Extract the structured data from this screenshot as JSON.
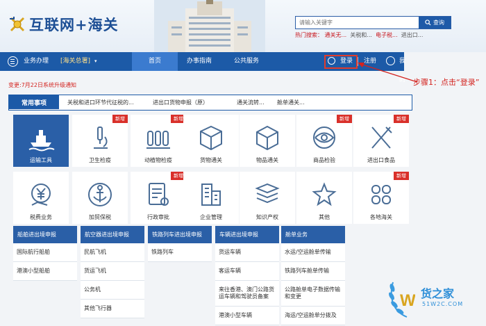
{
  "header": {
    "logo_text": "互联网+海关",
    "search": {
      "placeholder": "请输入关键字",
      "button": "查询"
    },
    "hot": {
      "label": "热门搜索：",
      "items": [
        "通关无...",
        "关税和...",
        "电子税...",
        "进出口..."
      ]
    }
  },
  "nav": {
    "business": "业务办理",
    "office": "[海关总署]",
    "home": "首页",
    "guide": "办事指南",
    "public": "公共服务",
    "login": "登录",
    "register": "注册",
    "mine": "我的"
  },
  "annotation": "步骤1：点击“登录”",
  "notice": "变更:7月22日系统升级通知",
  "quick": {
    "tab": "常用事项",
    "links": [
      "关税和进口环节代征税的...",
      "进出口货物申报（原）",
      "通关流转...",
      "舱单通关..."
    ]
  },
  "tiles": [
    {
      "label": "运输工具",
      "icon": "ship-icon",
      "new": false,
      "active": true
    },
    {
      "label": "卫生检疫",
      "icon": "microscope-icon",
      "new": true,
      "active": false
    },
    {
      "label": "动植物检疫",
      "icon": "plant-icon",
      "new": true,
      "active": false
    },
    {
      "label": "货物通关",
      "icon": "box-icon",
      "new": false,
      "active": false
    },
    {
      "label": "物品通关",
      "icon": "cube-icon",
      "new": false,
      "active": false
    },
    {
      "label": "商品检验",
      "icon": "eye-icon",
      "new": true,
      "active": false
    },
    {
      "label": "进出口食品",
      "icon": "utensils-icon",
      "new": true,
      "active": false
    },
    {
      "label": "税费业务",
      "icon": "yen-icon",
      "new": false,
      "active": false
    },
    {
      "label": "加贸保税",
      "icon": "anchor-icon",
      "new": false,
      "active": false
    },
    {
      "label": "行政审批",
      "icon": "document-icon",
      "new": true,
      "active": false
    },
    {
      "label": "企业管理",
      "icon": "building-icon",
      "new": false,
      "active": false
    },
    {
      "label": "知识产权",
      "icon": "layers-icon",
      "new": false,
      "active": false
    },
    {
      "label": "其他",
      "icon": "pin-icon",
      "new": false,
      "active": false
    },
    {
      "label": "各地海关",
      "icon": "clover-icon",
      "new": true,
      "active": false
    }
  ],
  "columns": [
    {
      "title": "船舶进出境申报",
      "items": [
        "国际航行船舶",
        "港澳小型船舶"
      ]
    },
    {
      "title": "航空器进出境申报",
      "items": [
        "民航飞机",
        "货运飞机",
        "公务机",
        "其他飞行器"
      ]
    },
    {
      "title": "铁路列车进出境申报",
      "items": [
        "铁路列车"
      ]
    },
    {
      "title": "车辆进出境申报",
      "items": [
        "货运车辆",
        "客运车辆",
        "来往香港、澳门公路货运车辆和驾驶员备案",
        "港澳小型车辆"
      ]
    },
    {
      "title": "舱单业务",
      "items": [
        "水运/空运舱单传输",
        "铁路列车舱单传输",
        "公路舱单电子数据传输和变更",
        "海运/空运舱单分拨及"
      ]
    }
  ],
  "watermark": {
    "name": "货之家",
    "url": "51W2C.COM"
  },
  "colors": {
    "primary": "#1c5aa7",
    "tile_active": "#2a5fa7",
    "alert": "#d3231f"
  }
}
